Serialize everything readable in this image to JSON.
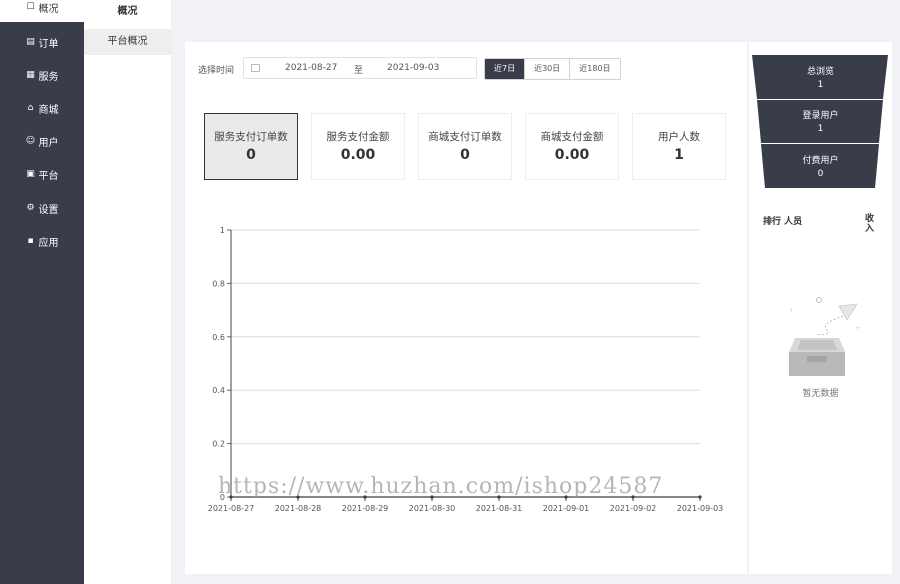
{
  "sidebar": {
    "items": [
      {
        "label": "概况",
        "icon": "chat-icon",
        "glyph": "☐",
        "active": true
      },
      {
        "label": "订单",
        "icon": "order-icon",
        "glyph": "▤",
        "active": false
      },
      {
        "label": "服务",
        "icon": "service-icon",
        "glyph": "▦",
        "active": false
      },
      {
        "label": "商城",
        "icon": "shop-icon",
        "glyph": "⌂",
        "active": false
      },
      {
        "label": "用户",
        "icon": "user-icon",
        "glyph": "☺",
        "active": false
      },
      {
        "label": "平台",
        "icon": "platform-icon",
        "glyph": "▣",
        "active": false
      },
      {
        "label": "设置",
        "icon": "gear-icon",
        "glyph": "⚙",
        "active": false
      },
      {
        "label": "应用",
        "icon": "apps-icon",
        "glyph": "▪",
        "active": false
      }
    ]
  },
  "subsidebar": {
    "title": "概况",
    "item": "平台概况"
  },
  "filter": {
    "label": "选择时间",
    "start": "2021-08-27",
    "separator": "至",
    "end": "2021-09-03",
    "ranges": [
      {
        "label": "近7日",
        "active": true
      },
      {
        "label": "近30日",
        "active": false
      },
      {
        "label": "近180日",
        "active": false
      }
    ]
  },
  "cards": [
    {
      "label": "服务支付订单数",
      "value": "0",
      "selected": true
    },
    {
      "label": "服务支付金额",
      "value": "0.00",
      "selected": false
    },
    {
      "label": "商城支付订单数",
      "value": "0",
      "selected": false
    },
    {
      "label": "商城支付金额",
      "value": "0.00",
      "selected": false
    },
    {
      "label": "用户人数",
      "value": "1",
      "selected": false
    }
  ],
  "chart_data": {
    "type": "line",
    "categories": [
      "2021-08-27",
      "2021-08-28",
      "2021-08-29",
      "2021-08-30",
      "2021-08-31",
      "2021-09-01",
      "2021-09-02",
      "2021-09-03"
    ],
    "series": [
      {
        "values": [
          0,
          0,
          0,
          0,
          0,
          0,
          0,
          0
        ]
      }
    ],
    "yticks": [
      "0",
      "0.2",
      "0.4",
      "0.6",
      "0.8",
      "1"
    ],
    "ylim": [
      0,
      1
    ],
    "grid": true,
    "title": "",
    "xlabel": "",
    "ylabel": ""
  },
  "watermark": "https://www.huzhan.com/ishop24587",
  "funnel": [
    {
      "label": "总浏览",
      "value": "1"
    },
    {
      "label": "登录用户",
      "value": "1"
    },
    {
      "label": "付费用户",
      "value": "0"
    }
  ],
  "ranking": {
    "head": "排行 人员",
    "income": "收入",
    "empty": "暂无数据"
  },
  "colors": {
    "sidebar": "#393d49",
    "accent": "#393d49",
    "funnel": "#393d49"
  }
}
